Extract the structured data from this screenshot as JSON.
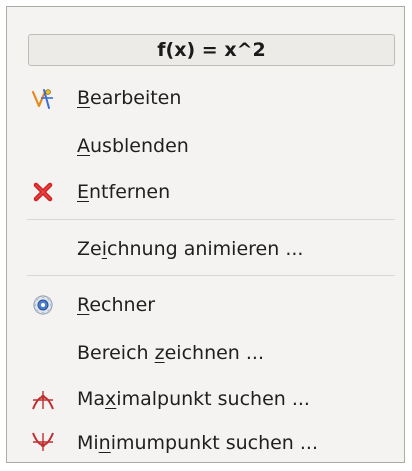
{
  "menu": {
    "title": "f(x) = x^2",
    "items": [
      {
        "label_pre": "",
        "label_mn": "B",
        "label_post": "earbeiten",
        "icon": "edit-graph-icon"
      },
      {
        "label_pre": "",
        "label_mn": "A",
        "label_post": "usblenden",
        "icon": ""
      },
      {
        "label_pre": "",
        "label_mn": "E",
        "label_post": "ntfernen",
        "icon": "remove-x-icon"
      },
      {
        "label_pre": "Ze",
        "label_mn": "i",
        "label_post": "chnung animieren ...",
        "icon": ""
      },
      {
        "label_pre": "",
        "label_mn": "R",
        "label_post": "echner",
        "icon": "calculator-gear-icon"
      },
      {
        "label_pre": "Bereich ",
        "label_mn": "z",
        "label_post": "eichnen ...",
        "icon": ""
      },
      {
        "label_pre": "Ma",
        "label_mn": "x",
        "label_post": "imalpunkt suchen ...",
        "icon": "maximum-point-icon"
      },
      {
        "label_pre": "Mi",
        "label_mn": "n",
        "label_post": "imumpunkt suchen ...",
        "icon": "minimum-point-icon"
      }
    ]
  },
  "colors": {
    "remove_red": "#d42020",
    "edit_orange": "#e8891c",
    "edit_blue": "#3a6fd8",
    "extremum_red": "#c03030",
    "gear_blue": "#4a7fd0"
  }
}
